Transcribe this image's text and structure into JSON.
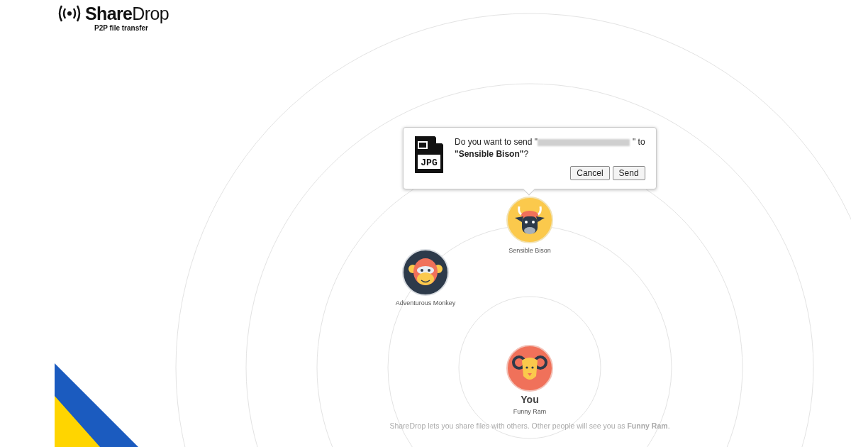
{
  "header": {
    "logo": "**Share**Drop",
    "tagline": "P2P file transfer"
  },
  "dialog": {
    "file_type": "JPG",
    "message_start": "Do you want to send \"",
    "filename_hidden": true,
    "message_end": "\" to",
    "recipient": "**\"Sensible Bison\"**?",
    "buttons": [
      "Cancel",
      "Send"
    ]
  },
  "peers": [
    {
      "name": "Sensible Bison",
      "kind": "bison"
    },
    {
      "name": "Adventurous Monkey",
      "kind": "monkey"
    }
  ],
  "self": {
    "label": "You",
    "name": "Funny Ram",
    "kind": "ram"
  },
  "footer": "ShareDrop lets you share files with others. Other people will see you as **Funny Ram**."
}
